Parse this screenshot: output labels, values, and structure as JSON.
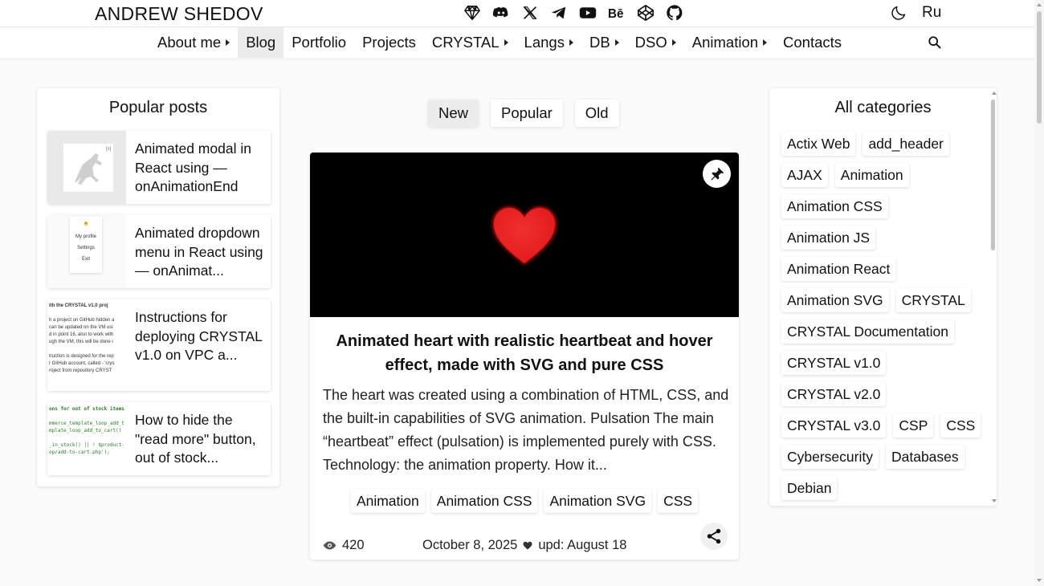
{
  "header": {
    "brand": "ANDREW SHEDOV",
    "social_icons": [
      "gem-icon",
      "discord-icon",
      "x-icon",
      "telegram-icon",
      "youtube-icon",
      "behance-icon",
      "codepen-icon",
      "github-icon"
    ],
    "theme_icon": "moon-icon",
    "language": "Ru"
  },
  "nav": {
    "items": [
      {
        "label": "About me",
        "dropdown": true
      },
      {
        "label": "Blog",
        "dropdown": false,
        "active": true
      },
      {
        "label": "Portfolio",
        "dropdown": false
      },
      {
        "label": "Projects",
        "dropdown": false
      },
      {
        "label": "CRYSTAL",
        "dropdown": true
      },
      {
        "label": "Langs",
        "dropdown": true
      },
      {
        "label": "DB",
        "dropdown": true
      },
      {
        "label": "DSO",
        "dropdown": true
      },
      {
        "label": "Animation",
        "dropdown": true
      },
      {
        "label": "Contacts",
        "dropdown": false
      }
    ]
  },
  "popular": {
    "title": "Popular posts",
    "posts": [
      {
        "title": "Animated modal in React using — onAnimationEnd"
      },
      {
        "title": "Animated dropdown menu in React using — onAnimat...",
        "thumb_menu": [
          "My profile",
          "Settings",
          "Exit"
        ]
      },
      {
        "title": "Instructions for deploying CRYSTAL v1.0 on VPC a...",
        "thumb_lines": [
          "ith the CRYSTAL v1.0 proj",
          "",
          "h a project on GitHub hidden a",
          "can be updated on the VM usi",
          "d in point 16, also to work with",
          "ugh the VM, this will be done i",
          "",
          "truction is designed for the rep",
          "r GitHub account, called - 'crys",
          "roject from repository CRYST"
        ]
      },
      {
        "title": "How to hide the \"read more\" button, out of stock...",
        "thumb_lines": [
          "ons for out of stock items",
          "",
          "mmerce_template_loop_add_t",
          "mplate_loop_add_to_cart()",
          "",
          "_in_stock() || ! $product-",
          "op/add-to-cart.php');"
        ]
      }
    ]
  },
  "sort": {
    "options": [
      {
        "label": "New",
        "active": true
      },
      {
        "label": "Popular"
      },
      {
        "label": "Old"
      }
    ]
  },
  "article": {
    "title": "Animated heart with realistic heartbeat and hover effect, made with SVG and pure CSS",
    "excerpt": "The heart was created using a combination of HTML, CSS, and the built-in capabilities of SVG animation. Pulsation The main “heartbeat” effect (pulsation) is implemented purely with CSS. Technology: the animation property. How it...",
    "tags": [
      "Animation",
      "Animation CSS",
      "Animation SVG",
      "CSS"
    ],
    "views": "420",
    "date": "October 8, 2025",
    "updated": "upd: August 18",
    "heart_color": "#e21b1b"
  },
  "categories": {
    "title": "All categories",
    "items": [
      "Actix Web",
      "add_header",
      "AJAX",
      "Animation",
      "Animation CSS",
      "Animation JS",
      "Animation React",
      "Animation SVG",
      "CRYSTAL",
      "CRYSTAL Documentation",
      "CRYSTAL v1.0",
      "CRYSTAL v2.0",
      "CRYSTAL v3.0",
      "CSP",
      "CSS",
      "Cybersecurity",
      "Databases",
      "Debian"
    ]
  }
}
